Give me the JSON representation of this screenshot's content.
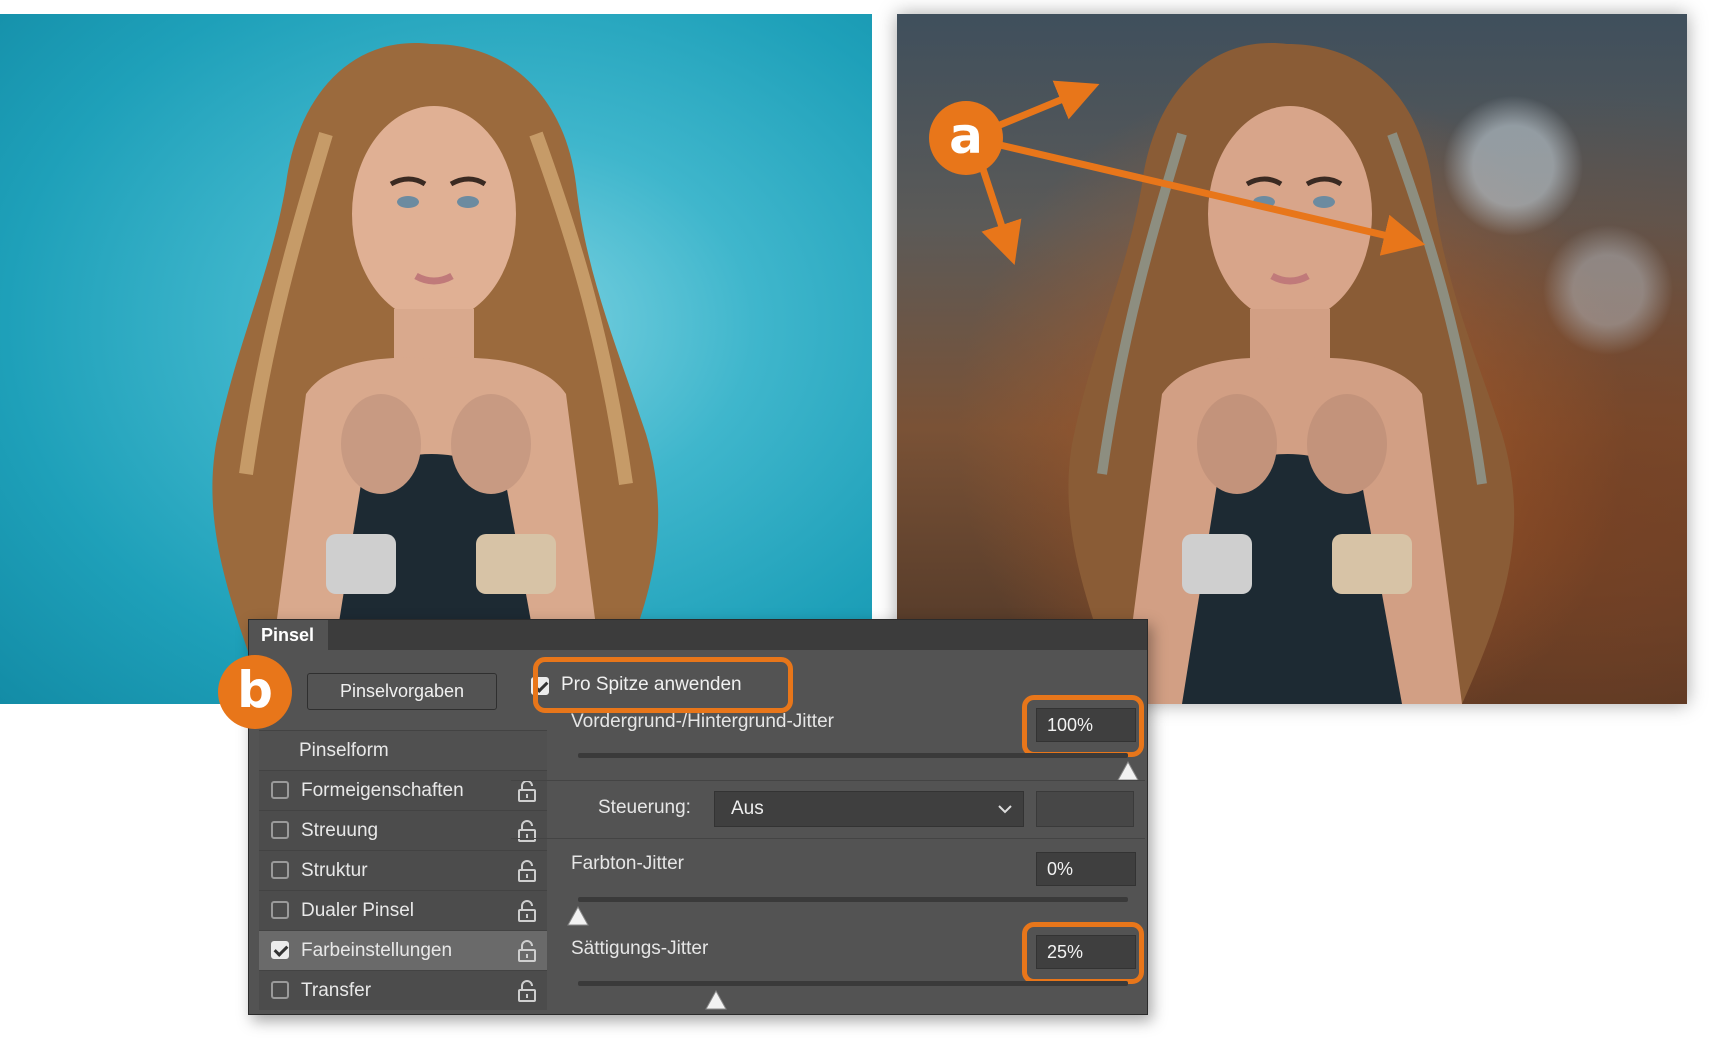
{
  "badges": {
    "a": "a",
    "b": "b"
  },
  "panel": {
    "tab": "Pinsel",
    "preset_button": "Pinselvorgaben",
    "apply_per_tip": {
      "label": "Pro Spitze anwenden",
      "checked": true
    },
    "list": [
      {
        "label": "Pinselform",
        "header": true
      },
      {
        "label": "Formeigenschaften",
        "checked": false
      },
      {
        "label": "Streuung",
        "checked": false
      },
      {
        "label": "Struktur",
        "checked": false
      },
      {
        "label": "Dualer Pinsel",
        "checked": false
      },
      {
        "label": "Farbeinstellungen",
        "checked": true,
        "selected": true
      },
      {
        "label": "Transfer",
        "checked": false
      }
    ],
    "fg_bg_jitter": {
      "label": "Vordergrund-/Hintergrund-Jitter",
      "value": "100%",
      "level": 1.0
    },
    "control": {
      "label": "Steuerung:",
      "value": "Aus"
    },
    "hue_jitter": {
      "label": "Farbton-Jitter",
      "value": "0%",
      "level": 0.0
    },
    "saturation_jitter": {
      "label": "Sättigungs-Jitter",
      "value": "25%",
      "level": 0.25
    }
  },
  "colors": {
    "accent": "#e8761a",
    "panel": "#535353"
  }
}
